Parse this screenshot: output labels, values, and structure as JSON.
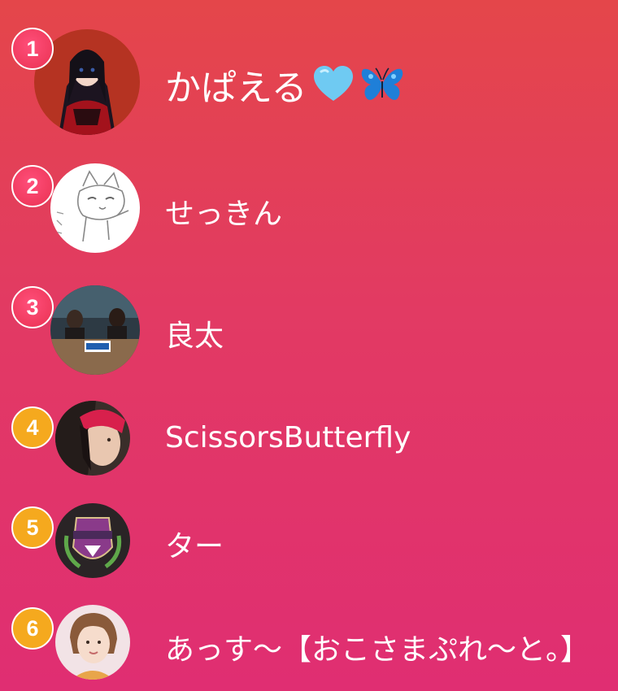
{
  "ranking": [
    {
      "rank": "1",
      "name": "かぱえる",
      "badge_color": "#f03a5e",
      "emoji": [
        "light-blue-heart-icon",
        "blue-butterfly-icon"
      ]
    },
    {
      "rank": "2",
      "name": "せっきん",
      "badge_color": "#f03a5e"
    },
    {
      "rank": "3",
      "name": "良太",
      "badge_color": "#f03a5e"
    },
    {
      "rank": "4",
      "name": "ScissorsButterfly",
      "badge_color": "#f5a91e"
    },
    {
      "rank": "5",
      "name": "ター",
      "badge_color": "#f5a91e"
    },
    {
      "rank": "6",
      "name": "あっす〜【おこさまぷれ〜と。】",
      "badge_color": "#f5a91e"
    }
  ],
  "colors": {
    "background_top": "#e4464a",
    "background_bottom": "#e02e72",
    "text": "#ffffff"
  }
}
